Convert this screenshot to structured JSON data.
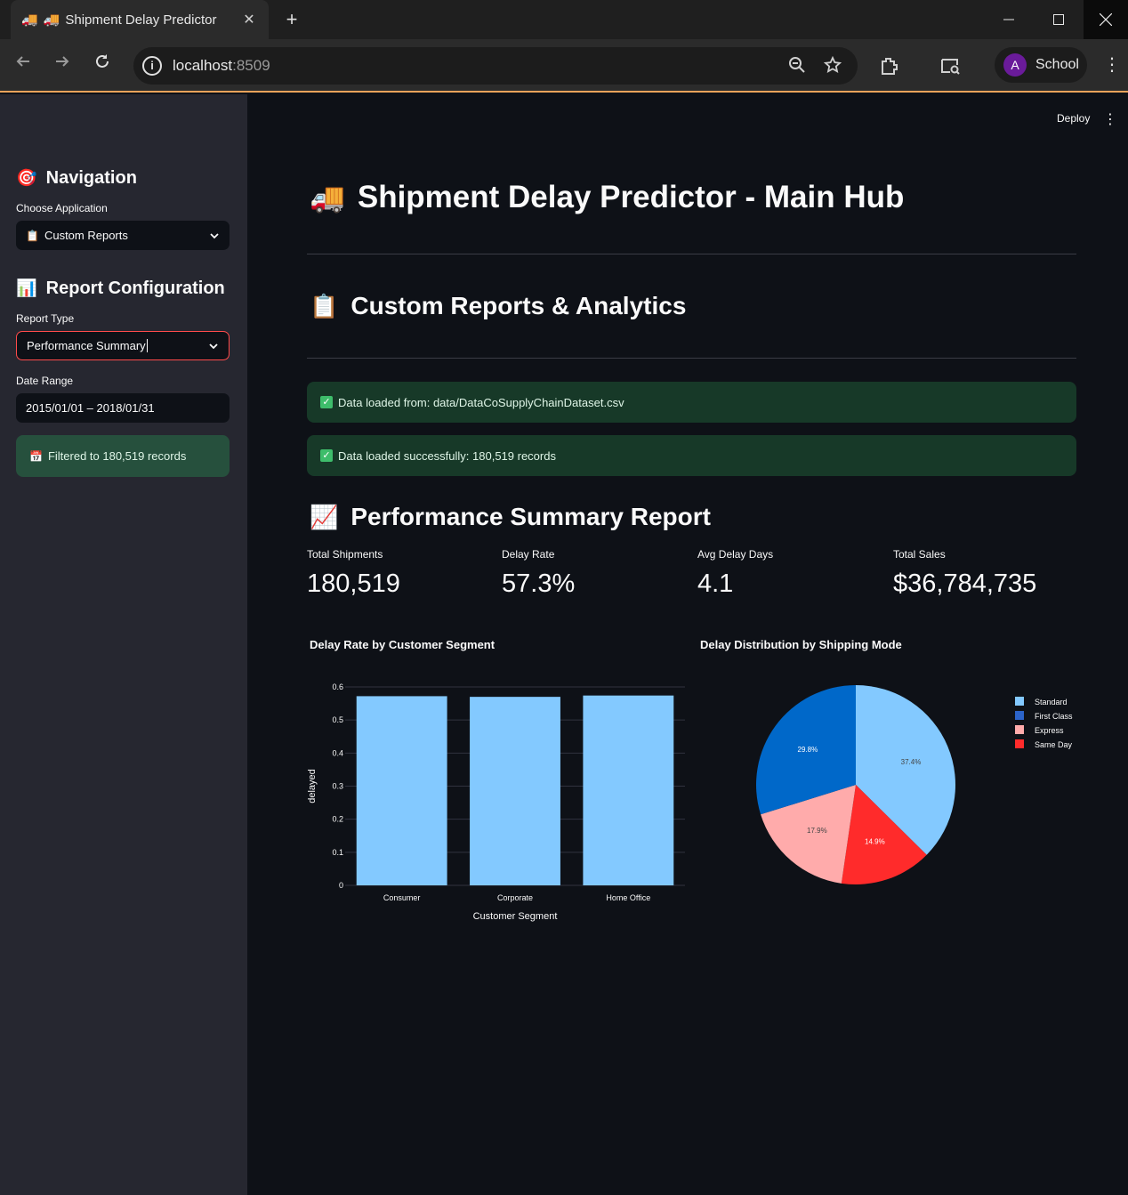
{
  "browser": {
    "tab_title": "Shipment Delay Predictor",
    "tab_favicon": "🚚",
    "url_host": "localhost",
    "url_port": ":8509",
    "profile_initial": "A",
    "profile_name": "School"
  },
  "app": {
    "deploy_label": "Deploy"
  },
  "sidebar": {
    "nav_heading": "Navigation",
    "nav_icon": "🎯",
    "choose_app_label": "Choose Application",
    "choose_app_value": "Custom Reports",
    "choose_app_icon": "📋",
    "report_heading": "Report Configuration",
    "report_icon": "📊",
    "report_type_label": "Report Type",
    "report_type_value": "Performance Summary",
    "date_range_label": "Date Range",
    "date_range_value": "2015/01/01 – 2018/01/31",
    "filter_icon": "📅",
    "filter_info": "Filtered to 180,519 records"
  },
  "main": {
    "title": "Shipment Delay Predictor - Main Hub",
    "title_icon": "🚚",
    "section_title": "Custom Reports & Analytics",
    "section_icon": "📋",
    "alert_1": "Data loaded from: data/DataCoSupplyChainDataset.csv",
    "alert_2": "Data loaded successfully: 180,519 records",
    "report_title": "Performance Summary Report",
    "report_icon": "📈",
    "metrics": [
      {
        "label": "Total Shipments",
        "value": "180,519"
      },
      {
        "label": "Delay Rate",
        "value": "57.3%"
      },
      {
        "label": "Avg Delay Days",
        "value": "4.1"
      },
      {
        "label": "Total Sales",
        "value": "$36,784,735"
      }
    ]
  },
  "chart_data": [
    {
      "type": "bar",
      "title": "Delay Rate by Customer Segment",
      "xlabel": "Customer Segment",
      "ylabel": "delayed",
      "categories": [
        "Consumer",
        "Corporate",
        "Home Office"
      ],
      "values": [
        0.572,
        0.57,
        0.574
      ],
      "ylim": [
        0,
        0.6
      ],
      "yticks": [
        "0",
        "0.1",
        "0.2",
        "0.3",
        "0.4",
        "0.5",
        "0.6"
      ],
      "color": "#83c9ff",
      "grid": true
    },
    {
      "type": "pie",
      "title": "Delay Distribution by Shipping Mode",
      "labels": [
        "Standard",
        "Same Day",
        "Express",
        "First Class"
      ],
      "values": [
        37.4,
        14.9,
        17.9,
        29.8
      ],
      "value_labels": [
        "37.4%",
        "14.9%",
        "17.9%",
        "29.8%"
      ],
      "colors": [
        "#83c9ff",
        "#ff2b2b",
        "#ffabab",
        "#0068c9"
      ],
      "legend": [
        "Standard",
        "First Class",
        "Express",
        "Same Day"
      ],
      "legend_colors": [
        "#83c9ff",
        "#2b63c9",
        "#ffabab",
        "#ff2b2b"
      ],
      "legend_position": "top-right"
    }
  ]
}
